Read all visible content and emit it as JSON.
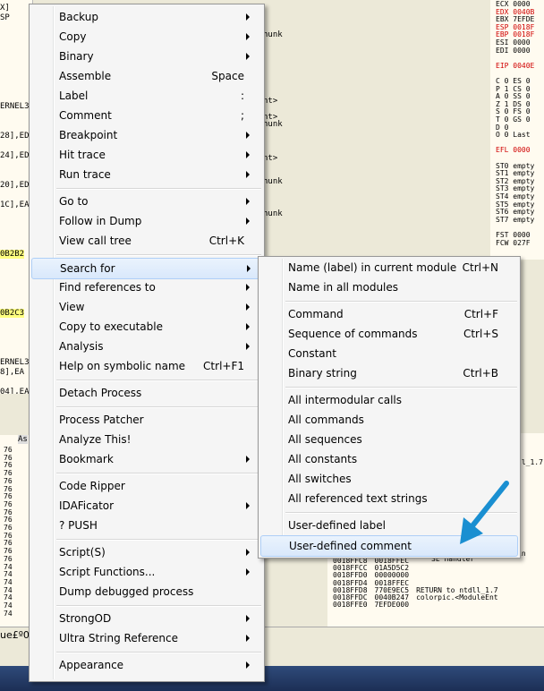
{
  "background": {
    "cpu_strip": [
      "X]",
      "SP",
      "",
      "",
      "",
      "",
      "",
      "",
      "",
      "",
      "ERNEL3",
      "",
      "",
      "28],ED",
      "",
      "24],ED",
      "",
      "",
      "20],ED",
      "",
      "1C],EA",
      "",
      "",
      "",
      "",
      "0B2B2",
      "",
      "",
      "",
      "",
      "",
      "0B2C3",
      "",
      "",
      "",
      "",
      "ERNEL3",
      "8],EA",
      "",
      "04],EA"
    ],
    "disasm_tail": [
      "hunk",
      "nt>",
      "nt>",
      "hunk",
      "nt>",
      "hunk",
      "hunk"
    ],
    "registers": [
      "ECX 0000",
      "EDX 0040B",
      "EBX 7EFDE",
      "ESP 0018F",
      "EBP 0018F",
      "ESI 0000",
      "EDI 0000",
      "",
      "EIP 0040E",
      "",
      "C 0  ES 0",
      "P 1  CS 0",
      "A 0  SS 0",
      "Z 1  DS 0",
      "S 0  FS 0",
      "T 0  GS 0",
      "D 0",
      "O 0  Last",
      "",
      "EFL 0000",
      "",
      "ST0 empty",
      "ST1 empty",
      "ST2 empty",
      "ST3 empty",
      "ST4 empty",
      "ST5 empty",
      "ST6 empty",
      "ST7 empty",
      "",
      "FST 0000",
      "FCW 027F"
    ],
    "dump_header": "As",
    "dump_lines": [
      "76",
      "76",
      "76",
      "76",
      "76",
      "76",
      "76",
      "76",
      "76",
      "76",
      "76",
      "76",
      "76",
      "76",
      "76",
      "74",
      "74",
      "74",
      "74",
      "74",
      "74",
      "74"
    ],
    "stack_rows": [
      {
        "addr": "0018FFC8",
        "val": "0018FFEC",
        "comment": ""
      },
      {
        "addr": "0018FFCC",
        "val": "01A5D5C2",
        "comment": ""
      },
      {
        "addr": "0018FFD0",
        "val": "00000000",
        "comment": ""
      },
      {
        "addr": "0018FFD4",
        "val": "0018FFEC",
        "comment": ""
      },
      {
        "addr": "0018FFD8",
        "val": "770E9EC5",
        "comment": "RETURN to ntdll_1.7"
      },
      {
        "addr": "0018FFDC",
        "val": "0040B247",
        "comment": "colorpic.<ModuleEnt"
      },
      {
        "addr": "0018FFE0",
        "val": "7EFDE000",
        "comment": ""
      }
    ],
    "stack_extra": [
      "SE handler",
      "ll_1.7",
      "in"
    ],
    "status_text": "ue£º0x"
  },
  "main_menu": {
    "items": [
      {
        "label": "Backup",
        "shortcut": "",
        "submenu": true
      },
      {
        "label": "Copy",
        "shortcut": "",
        "submenu": true
      },
      {
        "label": "Binary",
        "shortcut": "",
        "submenu": true
      },
      {
        "label": "Assemble",
        "shortcut": "Space",
        "submenu": false
      },
      {
        "label": "Label",
        "shortcut": ":",
        "submenu": false
      },
      {
        "label": "Comment",
        "shortcut": ";",
        "submenu": false
      },
      {
        "label": "Breakpoint",
        "shortcut": "",
        "submenu": true
      },
      {
        "label": "Hit trace",
        "shortcut": "",
        "submenu": true
      },
      {
        "label": "Run trace",
        "shortcut": "",
        "submenu": true
      },
      {
        "label": "Go to",
        "shortcut": "",
        "submenu": true
      },
      {
        "label": "Follow in Dump",
        "shortcut": "",
        "submenu": true
      },
      {
        "label": "View call tree",
        "shortcut": "Ctrl+K",
        "submenu": false
      },
      {
        "label": "Search for",
        "shortcut": "",
        "submenu": true
      },
      {
        "label": "Find references to",
        "shortcut": "",
        "submenu": true
      },
      {
        "label": "View",
        "shortcut": "",
        "submenu": true
      },
      {
        "label": "Copy to executable",
        "shortcut": "",
        "submenu": true
      },
      {
        "label": "Analysis",
        "shortcut": "",
        "submenu": true
      },
      {
        "label": "Help on symbolic name",
        "shortcut": "Ctrl+F1",
        "submenu": false
      },
      {
        "label": "Detach Process",
        "shortcut": "",
        "submenu": false
      },
      {
        "label": "Process Patcher",
        "shortcut": "",
        "submenu": false
      },
      {
        "label": "Analyze This!",
        "shortcut": "",
        "submenu": false
      },
      {
        "label": "Bookmark",
        "shortcut": "",
        "submenu": true
      },
      {
        "label": "Code Ripper",
        "shortcut": "",
        "submenu": false
      },
      {
        "label": "IDAFicator",
        "shortcut": "",
        "submenu": true
      },
      {
        "label": "? PUSH",
        "shortcut": "",
        "submenu": false
      },
      {
        "label": "Script(S)",
        "shortcut": "",
        "submenu": true
      },
      {
        "label": "Script Functions...",
        "shortcut": "",
        "submenu": true
      },
      {
        "label": "Dump debugged process",
        "shortcut": "",
        "submenu": false
      },
      {
        "label": "StrongOD",
        "shortcut": "",
        "submenu": true
      },
      {
        "label": "Ultra String Reference",
        "shortcut": "",
        "submenu": true
      },
      {
        "label": "Appearance",
        "shortcut": "",
        "submenu": true
      }
    ],
    "highlighted": "Search for"
  },
  "search_submenu": {
    "items": [
      {
        "label": "Name (label) in current module",
        "shortcut": "Ctrl+N"
      },
      {
        "label": "Name in all modules",
        "shortcut": ""
      },
      {
        "label": "Command",
        "shortcut": "Ctrl+F"
      },
      {
        "label": "Sequence of commands",
        "shortcut": "Ctrl+S"
      },
      {
        "label": "Constant",
        "shortcut": ""
      },
      {
        "label": "Binary string",
        "shortcut": "Ctrl+B"
      },
      {
        "label": "All intermodular calls",
        "shortcut": ""
      },
      {
        "label": "All commands",
        "shortcut": ""
      },
      {
        "label": "All sequences",
        "shortcut": ""
      },
      {
        "label": "All constants",
        "shortcut": ""
      },
      {
        "label": "All switches",
        "shortcut": ""
      },
      {
        "label": "All referenced text strings",
        "shortcut": ""
      },
      {
        "label": "User-defined label",
        "shortcut": ""
      },
      {
        "label": "User-defined comment",
        "shortcut": ""
      }
    ],
    "highlighted": "User-defined comment"
  },
  "colors": {
    "menu_bg": "#f5f5f5",
    "highlight": "#d9e8fb",
    "arrow": "#1a8fd1",
    "register_red": "#d00000"
  }
}
